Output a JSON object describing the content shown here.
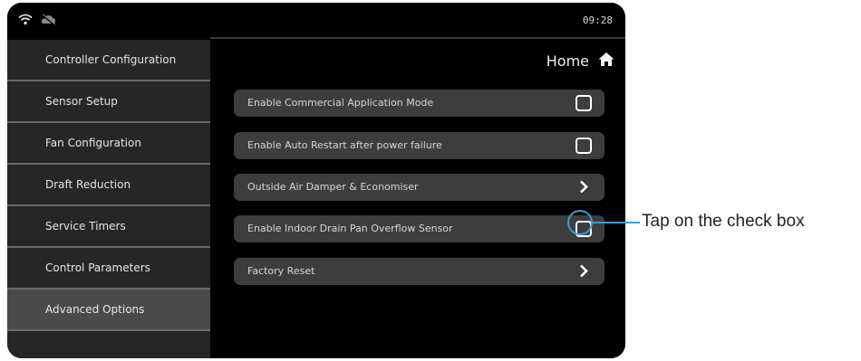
{
  "status": {
    "time": "09:28",
    "wifi_icon": "wifi-icon",
    "cloud_icon": "cloud-offline-icon"
  },
  "sidebar": {
    "items": [
      {
        "label": "Controller Configuration"
      },
      {
        "label": "Sensor Setup"
      },
      {
        "label": "Fan Configuration"
      },
      {
        "label": "Draft Reduction"
      },
      {
        "label": "Service Timers"
      },
      {
        "label": "Control Parameters"
      },
      {
        "label": "Advanced Options",
        "active": true
      }
    ]
  },
  "header": {
    "home_label": "Home",
    "home_icon": "home-icon"
  },
  "options": [
    {
      "label": "Enable Commercial Application Mode",
      "control": "checkbox",
      "checked": false
    },
    {
      "label": "Enable Auto Restart after power failure",
      "control": "checkbox",
      "checked": false
    },
    {
      "label": "Outside Air Damper & Economiser",
      "control": "chevron"
    },
    {
      "label": "Enable Indoor Drain Pan Overflow Sensor",
      "control": "checkbox",
      "checked": false
    },
    {
      "label": "Factory Reset",
      "control": "chevron"
    }
  ],
  "callout": {
    "text": "Tap on the check box",
    "color": "#3a9bd9"
  }
}
